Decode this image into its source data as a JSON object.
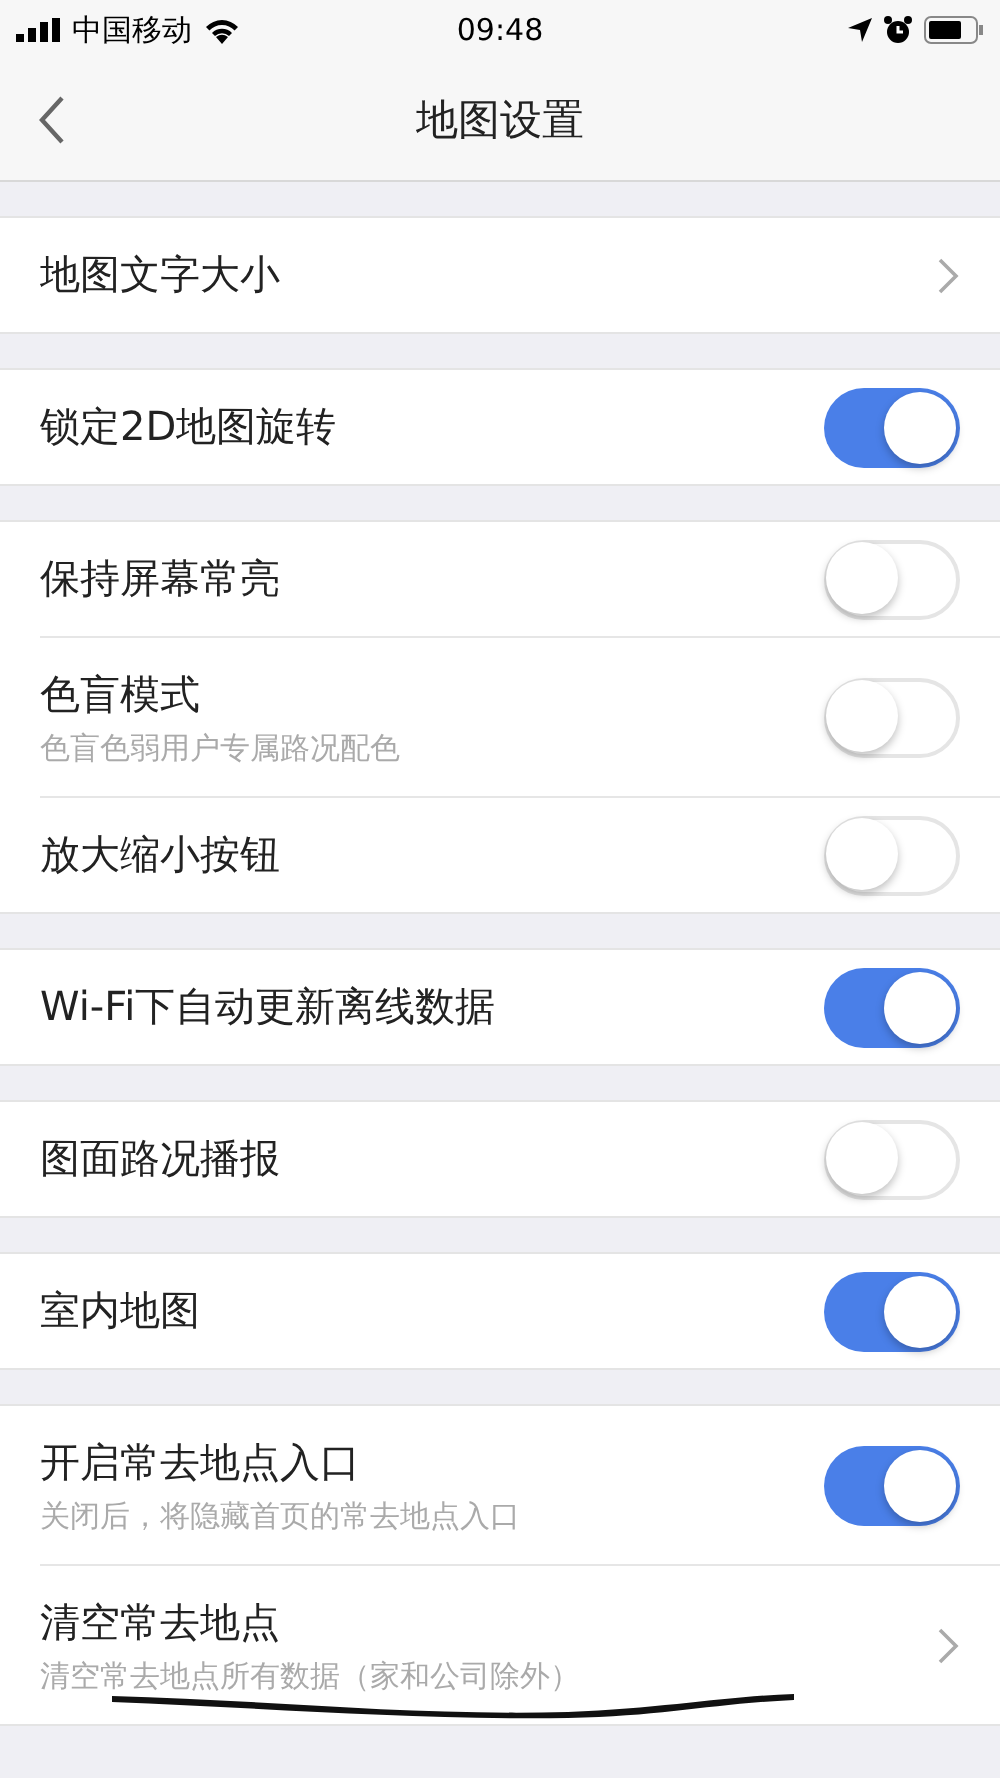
{
  "status_bar": {
    "carrier": "中国移动",
    "time": "09:48"
  },
  "nav": {
    "title": "地图设置"
  },
  "groups": [
    {
      "items": [
        {
          "kind": "link",
          "label": "地图文字大小"
        }
      ]
    },
    {
      "items": [
        {
          "kind": "toggle",
          "label": "锁定2D地图旋转",
          "on": true
        }
      ]
    },
    {
      "items": [
        {
          "kind": "toggle",
          "label": "保持屏幕常亮",
          "on": false
        },
        {
          "kind": "toggle",
          "label": "色盲模式",
          "subtitle": "色盲色弱用户专属路况配色",
          "on": false
        },
        {
          "kind": "toggle",
          "label": "放大缩小按钮",
          "on": false
        }
      ]
    },
    {
      "items": [
        {
          "kind": "toggle",
          "label": "Wi-Fi下自动更新离线数据",
          "on": true
        }
      ]
    },
    {
      "items": [
        {
          "kind": "toggle",
          "label": "图面路况播报",
          "on": false
        }
      ]
    },
    {
      "items": [
        {
          "kind": "toggle",
          "label": "室内地图",
          "on": true
        }
      ]
    },
    {
      "items": [
        {
          "kind": "toggle",
          "label": "开启常去地点入口",
          "subtitle": "关闭后，将隐藏首页的常去地点入口",
          "on": true
        },
        {
          "kind": "link",
          "label": "清空常去地点",
          "subtitle": "清空常去地点所有数据（家和公司除外）",
          "scribble": true
        }
      ]
    }
  ]
}
